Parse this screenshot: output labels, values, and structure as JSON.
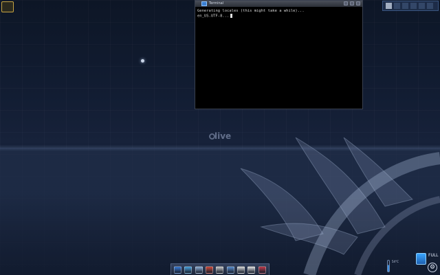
{
  "colors": {
    "desktop_bg": "#121d33",
    "terminal_bg": "#000000",
    "terminal_text": "#d8d8d8",
    "dock_accent": "#3b8de0"
  },
  "terminal": {
    "title": "Terminal",
    "lines": [
      "Generating locales (this might take a while)...",
      "  en_US.UTF-8..."
    ]
  },
  "desktop": {
    "watermark": "live"
  },
  "dock": {
    "items": [
      {
        "icon": "monitor-icon",
        "color": "#3a7bd5"
      },
      {
        "icon": "globe-icon",
        "color": "#4aa3df"
      },
      {
        "icon": "file-manager-icon",
        "color": "#8fb0d8"
      },
      {
        "icon": "media-player-icon",
        "color": "#d04a3a"
      },
      {
        "icon": "mail-icon",
        "color": "#c9c9c9"
      },
      {
        "icon": "chat-icon",
        "color": "#5a8fd0"
      },
      {
        "icon": "terminal-icon",
        "color": "#d8d8d8"
      },
      {
        "icon": "cd-burner-icon",
        "color": "#e0e0e0"
      },
      {
        "icon": "image-editor-icon",
        "color": "#c0394a"
      }
    ]
  },
  "tray": {
    "temperature": "54°C",
    "battery_label": "FULL"
  }
}
